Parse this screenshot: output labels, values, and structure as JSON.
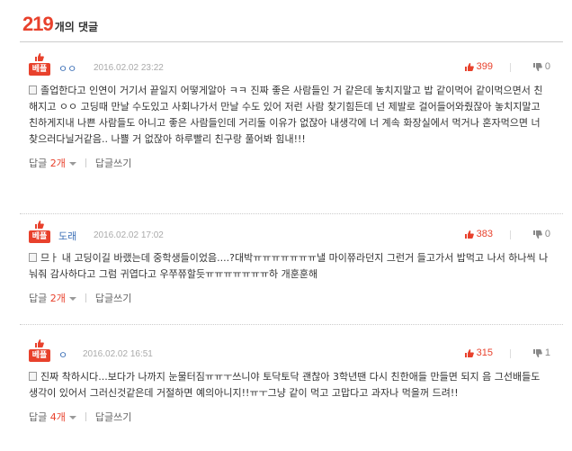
{
  "header": {
    "count": "219",
    "count_label": "개의 댓글"
  },
  "comments": [
    {
      "best_label": "베플",
      "author": "ㅇㅇ",
      "date": "2016.02.02 23:22",
      "up": "399",
      "down": "0",
      "text": "졸업한다고 인연이 거기서 끝일지 어떻게알아 ㅋㅋ 진짜 좋은 사람들인 거 같은데 놓치지말고 밥 같이먹어 같이먹으면서 친해지고 ㅇㅇ 고딩때 만날 수도있고 사회나가서 만날 수도 있어 저런 사람 찾기힘든데 넌 제발로 걸어들어와줬잖아 놓치지말고 친하게지내 나쁜 사람들도 아니고 좋은 사람들인데 거리둘 이유가 없잖아 내생각에 너 계속 화장실에서 먹거나 혼자먹으면 너 찾으러다닐거같음.. 나쁠 거 없잖아 하루빨리 친구랑 풀어봐 힘내!!!",
      "reply_label": "답글",
      "reply_count": "2개",
      "write_label": "답글쓰기"
    },
    {
      "best_label": "베플",
      "author": "도래",
      "date": "2016.02.02 17:02",
      "up": "383",
      "down": "0",
      "text": "므ㅏ 내 고딩이길 바랬는데 중학생들이었음....?대박ㅠㅠㅠㅠㅠㅠㅠ낼 마이쮸라던지 그런거 들고가서 밥먹고 나서 하나씩 나눠줘 감사하다고 그럼 귀엽다고 우쭈쮸할듯ㅠㅠㅠㅠㅠㅠㅠ하 개훈훈해",
      "reply_label": "답글",
      "reply_count": "2개",
      "write_label": "답글쓰기"
    },
    {
      "best_label": "베플",
      "author": "ㅇ",
      "date": "2016.02.02 16:51",
      "up": "315",
      "down": "1",
      "text": "진짜 착하시다...보다가 나까지 눈물터짐ㅠㅠㅜ쓰니야 토닥토닥 괜찮아 3학년땐 다시 친한애들 만들면 되지 음 그선배들도 생각이 있어서 그러신것같은데 거절하면 예의아니지!!ㅠㅜ그냥 같이 먹고 고맙다고 과자나 먹을꺼 드려!!",
      "reply_label": "답글",
      "reply_count": "4개",
      "write_label": "답글쓰기"
    }
  ]
}
